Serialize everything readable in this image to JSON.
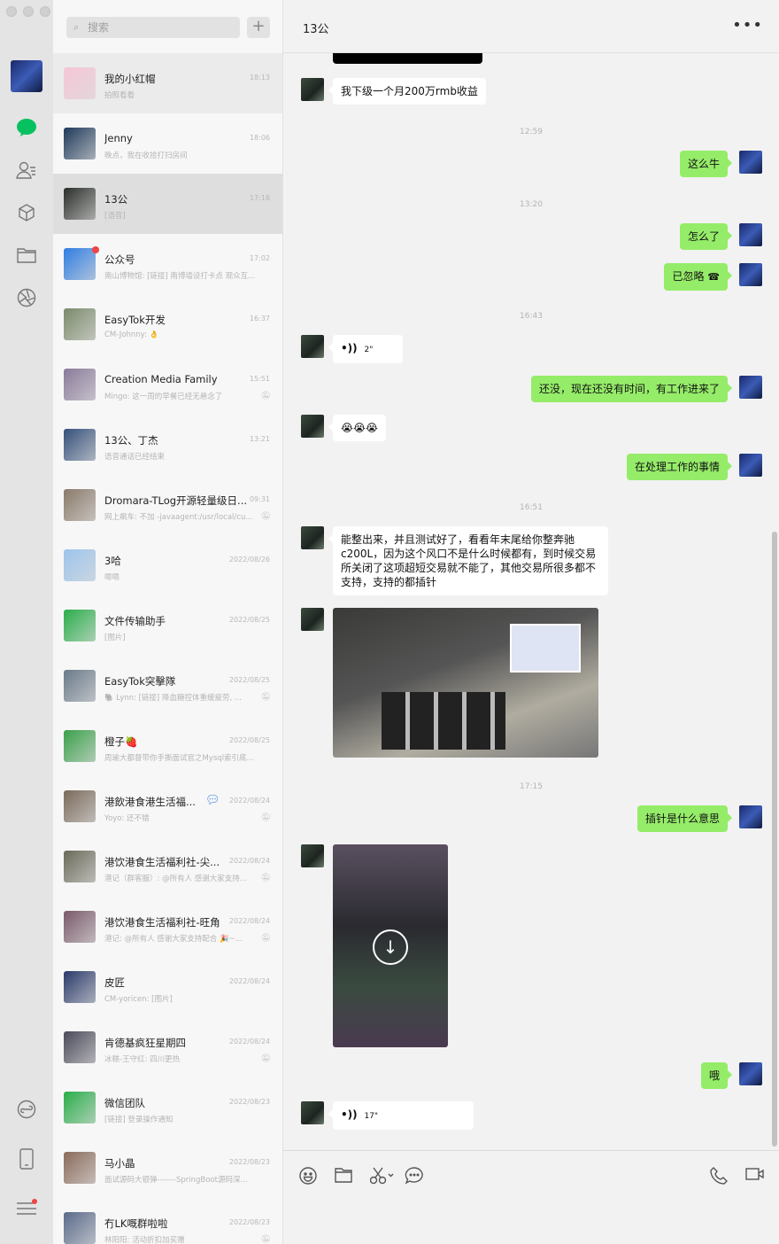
{
  "search": {
    "placeholder": "搜索",
    "add_label": "+"
  },
  "chat_list": [
    {
      "name": "我的小红帽",
      "time": "18:13",
      "preview": "拍照看看",
      "avatar": "#f6c6d6",
      "state": "pinned"
    },
    {
      "name": "Jenny",
      "time": "18:06",
      "preview": "晚点，我在收拾打扫房间",
      "avatar": "#1f3a5a"
    },
    {
      "name": "13公",
      "time": "17:18",
      "preview": "[语音]",
      "avatar": "#2a2e2a",
      "state": "selected"
    },
    {
      "name": "公众号",
      "time": "17:02",
      "preview": "南山博物馆: [链接] 南博墙设打卡点 观众互...",
      "avatar": "#2f7de1",
      "unread": true
    },
    {
      "name": "EasyTok开发",
      "time": "16:37",
      "preview": "CM-Johnny: 👌",
      "avatar": "#7a8a6a"
    },
    {
      "name": "Creation Media Family",
      "time": "15:51",
      "preview": "Mingo: 这一周的早餐已经无悬念了",
      "avatar": "#8a7a9a",
      "muted": true
    },
    {
      "name": "13公、丁杰",
      "time": "13:21",
      "preview": "语音通话已经结束",
      "avatar": "#35507a"
    },
    {
      "name": "Dromara-TLog开源轻量级日...",
      "time": "09:31",
      "preview": "网上飙车: 不加 -javaagent:/usr/local/cu...",
      "avatar": "#8a7a6a",
      "muted": true
    },
    {
      "name": "3哈",
      "time": "2022/08/26",
      "preview": "嗯嗯",
      "avatar": "#9cc4ec"
    },
    {
      "name": "文件传输助手",
      "time": "2022/08/25",
      "preview": "[图片]",
      "avatar": "#2aae4a"
    },
    {
      "name": "EasyTok突擊隊",
      "time": "2022/08/25",
      "preview": "🐘 Lynn: [链接] 降血糖控体重缓疲劳, ...",
      "avatar": "#6a7a8a",
      "muted": true
    },
    {
      "name": "橙子🍓",
      "time": "2022/08/25",
      "preview": "周瑜大都督带你手撕面试官之Mysql索引底...",
      "avatar": "#3aa04a"
    },
    {
      "name": "港飲港食港生活福...",
      "time": "2022/08/24",
      "preview": "Yoyo: 还不错",
      "avatar": "#7a6a5a",
      "muted": true,
      "badge_icon": "chat-bubble"
    },
    {
      "name": "港饮港食生活福利社-尖...",
      "time": "2022/08/24",
      "preview": "港记（群客服）: @所有人 感谢大家支持...",
      "avatar": "#6a6a5a",
      "muted": true
    },
    {
      "name": "港饮港食生活福利社-旺角",
      "time": "2022/08/24",
      "preview": "港记: @所有人 感谢大家支持配合 🎉~...",
      "avatar": "#7a5a6a",
      "muted": true
    },
    {
      "name": "皮匠",
      "time": "2022/08/24",
      "preview": "CM-yoricen: [图片]",
      "avatar": "#2a3a6a"
    },
    {
      "name": "肯德基疯狂星期四",
      "time": "2022/08/24",
      "preview": "冰糕-王守红: 四川更热",
      "avatar": "#4a4a5a",
      "muted": true
    },
    {
      "name": "微信团队",
      "time": "2022/08/23",
      "preview": "[链接] 登录操作通知",
      "avatar": "#2aae4a"
    },
    {
      "name": "马小晶",
      "time": "2022/08/23",
      "preview": "面试源码大银弹-------SpringBoot源码深...",
      "avatar": "#8a6a5a"
    },
    {
      "name": "冇LK嘅群啦啦",
      "time": "2022/08/23",
      "preview": "林阳阳: 活动折扣加买赠",
      "avatar": "#5a6a8a",
      "muted": true
    }
  ],
  "chat": {
    "title": "13公",
    "more": "•••",
    "messages": [
      {
        "type": "text",
        "side": "left",
        "text": "我下级一个月200万rmb收益"
      },
      {
        "type": "time",
        "text": "12:59"
      },
      {
        "type": "text",
        "side": "right",
        "text": "这么牛"
      },
      {
        "type": "time",
        "text": "13:20"
      },
      {
        "type": "text",
        "side": "right",
        "text": "怎么了"
      },
      {
        "type": "call",
        "side": "right",
        "text": "已忽略"
      },
      {
        "type": "time",
        "text": "16:43"
      },
      {
        "type": "voice",
        "side": "left",
        "text": "2\""
      },
      {
        "type": "text",
        "side": "right",
        "text": "还没，现在还没有时间，有工作进来了"
      },
      {
        "type": "text",
        "side": "left",
        "text": "😭😭😭"
      },
      {
        "type": "text",
        "side": "right",
        "text": "在处理工作的事情"
      },
      {
        "type": "time",
        "text": "16:51"
      },
      {
        "type": "text",
        "side": "left",
        "text": "能整出来，并且测试好了，看看年末尾给你整奔驰c200L，因为这个风口不是什么时候都有，到时候交易所关闭了这项超短交易就不能了，其他交易所很多都不支持，支持的都插针"
      },
      {
        "type": "image",
        "side": "left"
      },
      {
        "type": "time",
        "text": "17:15"
      },
      {
        "type": "text",
        "side": "right",
        "text": "插针是什么意思"
      },
      {
        "type": "video",
        "side": "left"
      },
      {
        "type": "text",
        "side": "right",
        "text": "哦"
      },
      {
        "type": "voice",
        "side": "left",
        "text": "17\""
      }
    ]
  },
  "colors": {
    "bubble_mine": "#95ec69",
    "accent": "#07c160",
    "unread": "#f04444"
  }
}
